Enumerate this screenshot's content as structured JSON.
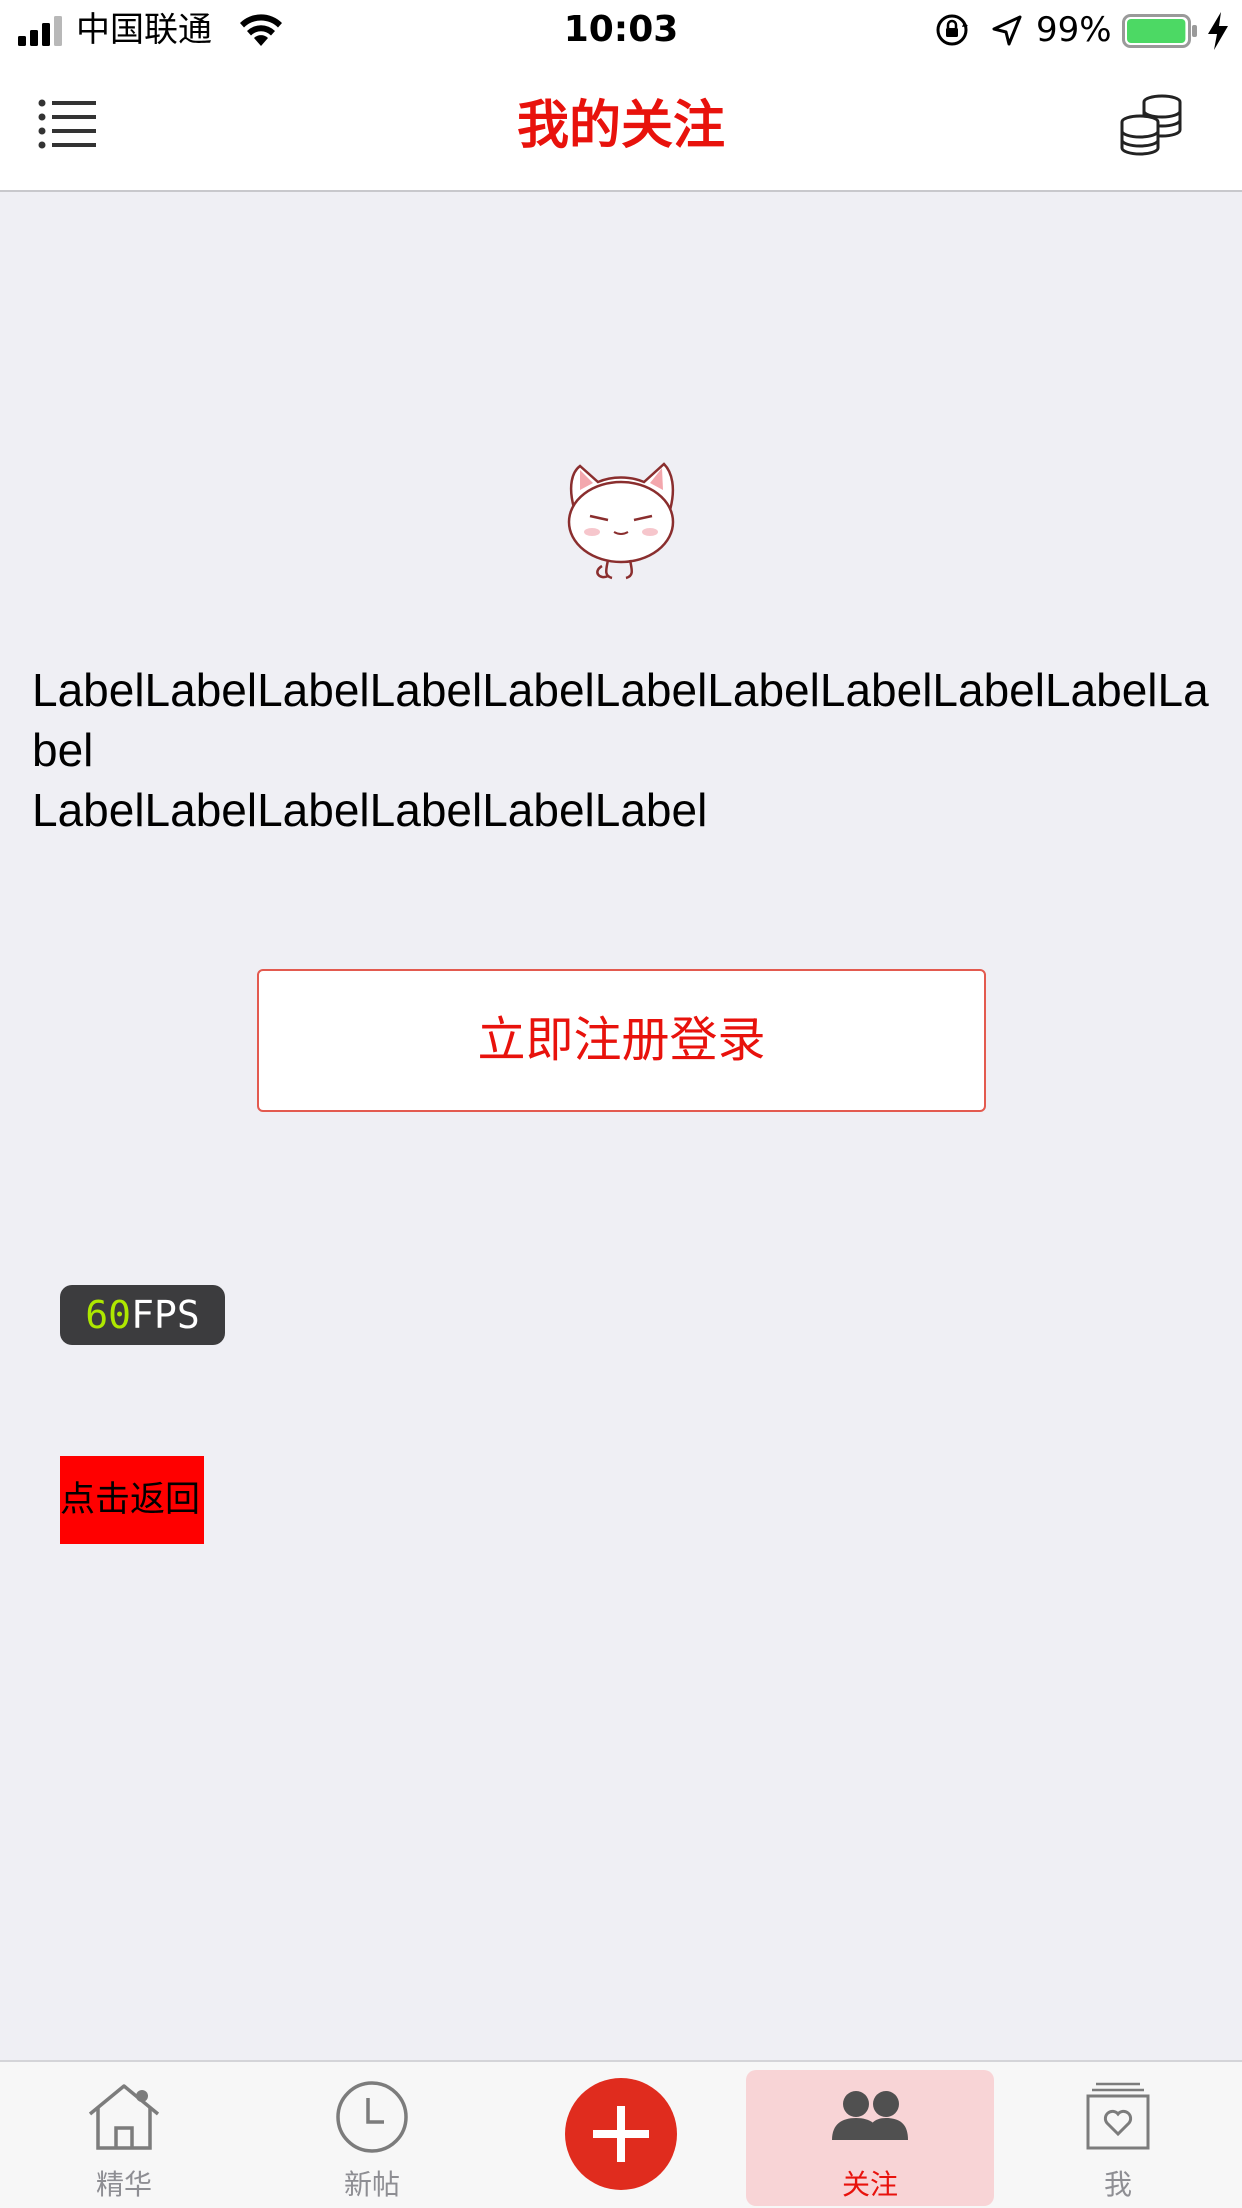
{
  "status_bar": {
    "carrier": "中国联通",
    "time": "10:03",
    "battery": "99%",
    "battery_level": 0.99
  },
  "nav": {
    "title": "我的关注",
    "left_icon": "menu-list-icon",
    "right_icon": "coins-stack-icon"
  },
  "content": {
    "image": "cat-illustration",
    "label_line1": "LabelLabelLabelLabelLabelLabelLabelLabelLabelLabelLabel",
    "label_line2": "LabelLabelLabelLabelLabelLabel",
    "register_button": "立即注册登录",
    "fps_value": "60",
    "fps_unit": "FPS",
    "back_button": "点击返回"
  },
  "tab_bar": {
    "tabs": [
      {
        "label": "精华",
        "icon": "house-icon"
      },
      {
        "label": "新帖",
        "icon": "clock-icon"
      },
      {
        "label": "",
        "icon": "plus-icon"
      },
      {
        "label": "关注",
        "icon": "people-icon",
        "active": true
      },
      {
        "label": "我",
        "icon": "heart-frame-icon"
      }
    ]
  },
  "colors": {
    "accent": "#e8120c",
    "background": "#efeff4",
    "active_tab_bg": "#f8d4d6",
    "back_button_bg": "#ff0000"
  }
}
